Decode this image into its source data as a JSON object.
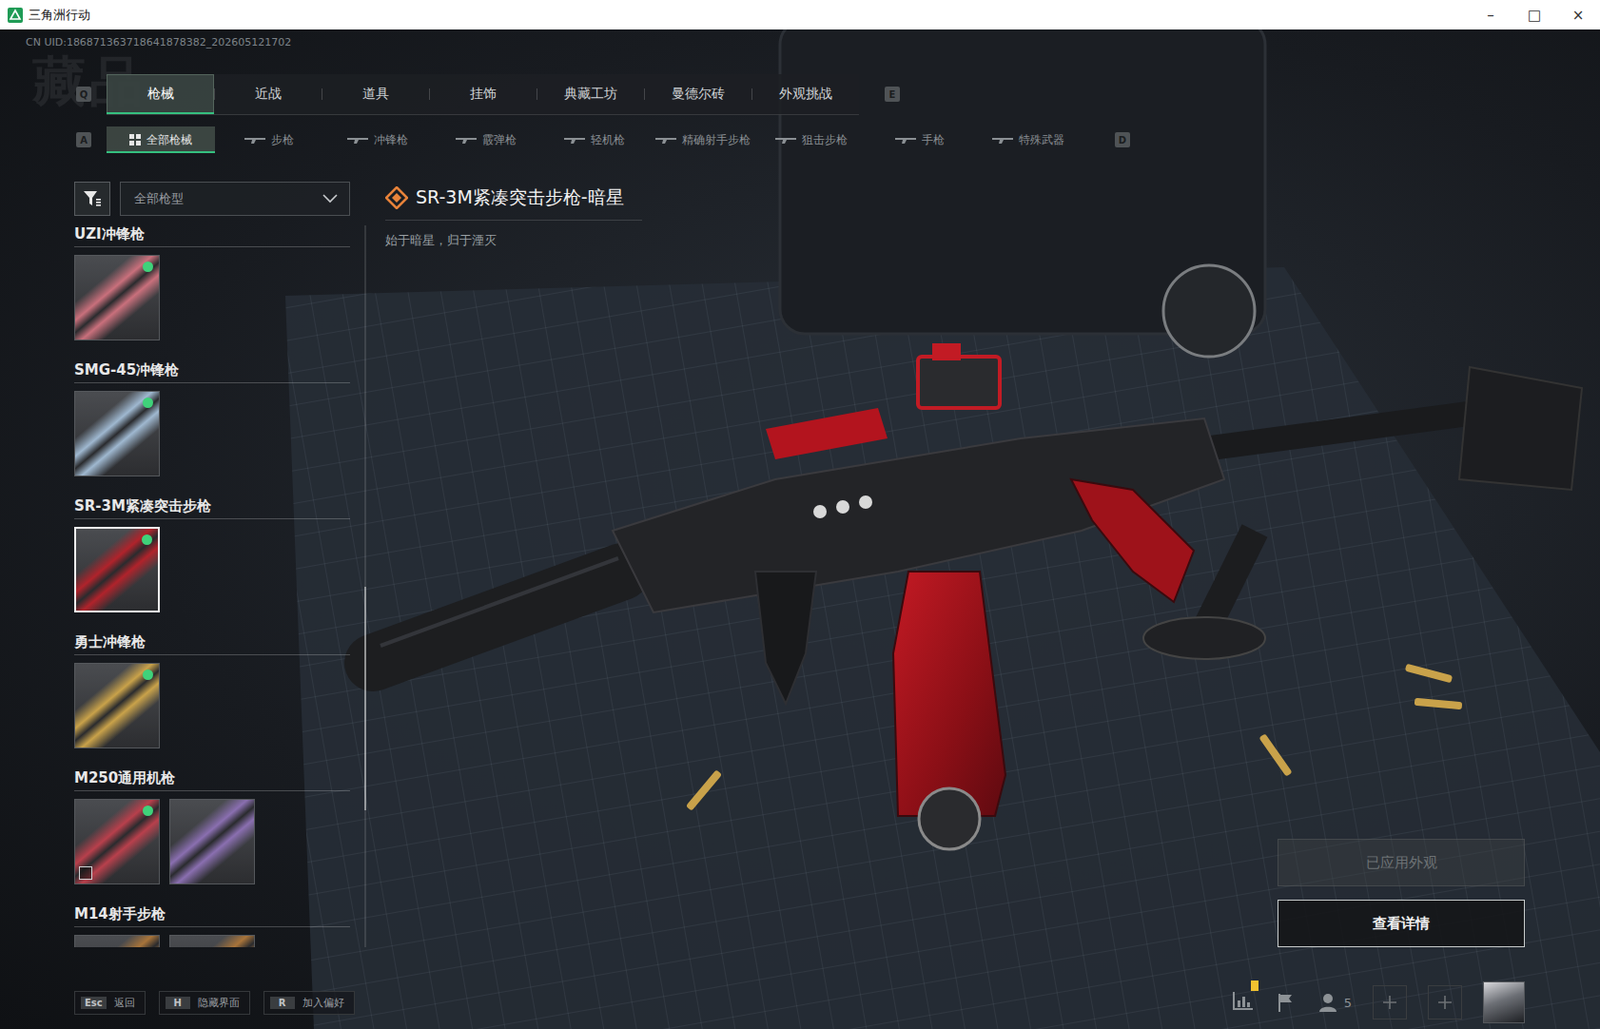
{
  "window": {
    "title": "三角洲行动",
    "controls": [
      "–",
      "□",
      "×"
    ]
  },
  "uid": "CN UID:186871363718641878382_202605121702",
  "watermark": "藏品",
  "tabs": {
    "prev_key": "Q",
    "next_key": "E",
    "items": [
      {
        "label": "枪械",
        "selected": true
      },
      {
        "label": "近战",
        "selected": false
      },
      {
        "label": "道具",
        "selected": false
      },
      {
        "label": "挂饰",
        "selected": false
      },
      {
        "label": "典藏工坊",
        "selected": false
      },
      {
        "label": "曼德尔砖",
        "selected": false
      },
      {
        "label": "外观挑战",
        "selected": false
      }
    ]
  },
  "subtabs": {
    "prev_key": "A",
    "next_key": "D",
    "items": [
      {
        "label": "全部枪械",
        "selected": true
      },
      {
        "label": "步枪",
        "selected": false
      },
      {
        "label": "冲锋枪",
        "selected": false
      },
      {
        "label": "霰弹枪",
        "selected": false
      },
      {
        "label": "轻机枪",
        "selected": false
      },
      {
        "label": "精确射手步枪",
        "selected": false
      },
      {
        "label": "狙击步枪",
        "selected": false
      },
      {
        "label": "手枪",
        "selected": false
      },
      {
        "label": "特殊武器",
        "selected": false
      }
    ]
  },
  "filter": {
    "value": "全部枪型"
  },
  "weapons": [
    {
      "name": "UZI冲锋枪",
      "skins": [
        {
          "equipped": true,
          "selected": false,
          "badge": false,
          "color": "#c9707c"
        }
      ]
    },
    {
      "name": "SMG-45冲锋枪",
      "skins": [
        {
          "equipped": true,
          "selected": false,
          "badge": false,
          "color": "#9fb8d0"
        }
      ]
    },
    {
      "name": "SR-3M紧凑突击步枪",
      "skins": [
        {
          "equipped": true,
          "selected": true,
          "badge": false,
          "color": "#b0232b"
        }
      ]
    },
    {
      "name": "勇士冲锋枪",
      "skins": [
        {
          "equipped": true,
          "selected": false,
          "badge": false,
          "color": "#c9a24a"
        }
      ]
    },
    {
      "name": "M250通用机枪",
      "skins": [
        {
          "equipped": true,
          "selected": false,
          "badge": true,
          "color": "#b8404c"
        },
        {
          "equipped": false,
          "selected": false,
          "badge": false,
          "color": "#8a6fb0"
        }
      ]
    },
    {
      "name": "M14射手步枪",
      "skins": [
        {
          "equipped": false,
          "selected": false,
          "badge": false,
          "color": "#a8743a"
        },
        {
          "equipped": false,
          "selected": false,
          "badge": false,
          "color": "#a8743a"
        }
      ]
    }
  ],
  "scrollbar": {
    "offset": 0.5,
    "level": 0.31
  },
  "detail": {
    "title": "SR-3M紧凑突击步枪-暗星",
    "subtitle": "始于暗星，归于湮灭"
  },
  "actions": [
    {
      "label": "已应用外观",
      "disabled": true
    },
    {
      "label": "查看详情",
      "disabled": false
    }
  ],
  "shortcuts": [
    {
      "key": "Esc",
      "label": "返回"
    },
    {
      "key": "H",
      "label": "隐藏界面"
    },
    {
      "key": "R",
      "label": "加入偏好"
    }
  ],
  "hud": {
    "squad_count": "5",
    "notice": true
  }
}
